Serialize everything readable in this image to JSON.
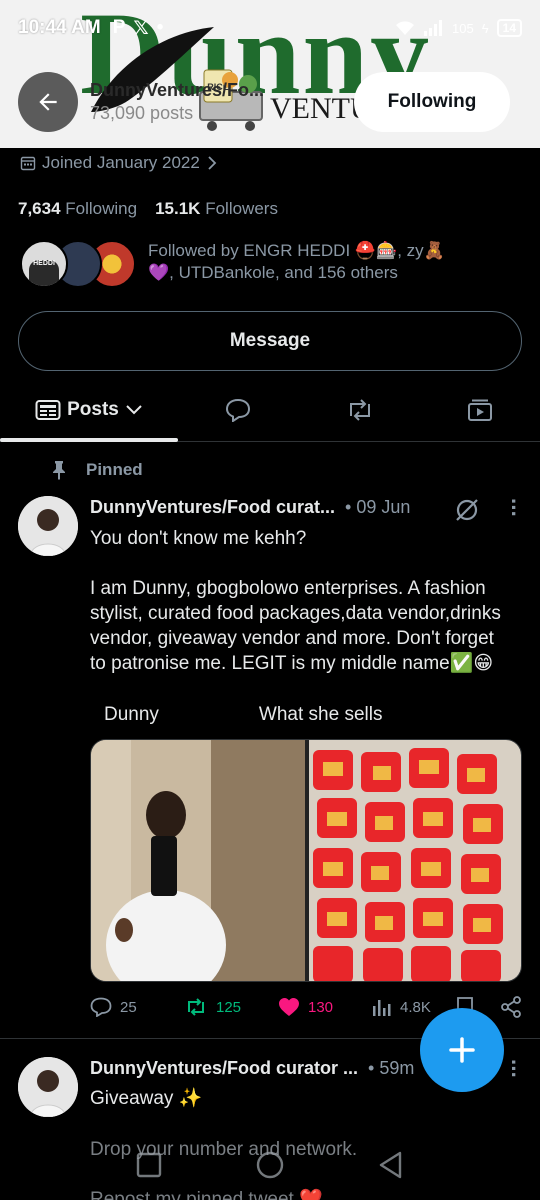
{
  "status_bar": {
    "time": "10:44 AM",
    "network_label": "105",
    "battery": "14"
  },
  "banner": {
    "brand_text": "Dunny",
    "brand_sub": "VENTURES",
    "basket_text": "RICE"
  },
  "header": {
    "title": "DunnyVentures/Fo...",
    "subtitle": "73,090 posts",
    "follow_label": "Following"
  },
  "profile": {
    "joined": "Joined January 2022",
    "following_count": "7,634",
    "following_label": "Following",
    "followers_count": "15.1K",
    "followers_label": "Followers",
    "avatar_badge": "HEDDI",
    "followed_by": "Followed by ENGR HEDDI ⛑️🎰, zy🧸💜, UTDBankole, and 156 others",
    "message_label": "Message"
  },
  "tabs": {
    "posts_label": "Posts"
  },
  "pinned_post": {
    "pinned_label": "Pinned",
    "author": "DunnyVentures/Food curat...",
    "time": "• 09 Jun",
    "text": "You don't know me kehh?\n\nI am Dunny, gbogbolowo enterprises. A fashion stylist, curated food packages,data vendor,drinks vendor, giveaway vendor and more. Don't forget to patronise me. LEGIT is my middle name✅😁",
    "image_label_1": "Dunny",
    "image_label_2": "What she sells",
    "replies": "25",
    "reposts": "125",
    "likes": "130",
    "views": "4.8K"
  },
  "second_post": {
    "author": "DunnyVentures/Food curator ...",
    "time": "• 59m",
    "line1": "Giveaway ✨",
    "line2": "Drop your number and network.",
    "line3": "Repost my pinned tweet ❤️"
  },
  "colors": {
    "accent": "#1d9bf0",
    "repost": "#00ba7c",
    "like": "#f91880",
    "brand_green": "#1f6b2d"
  }
}
